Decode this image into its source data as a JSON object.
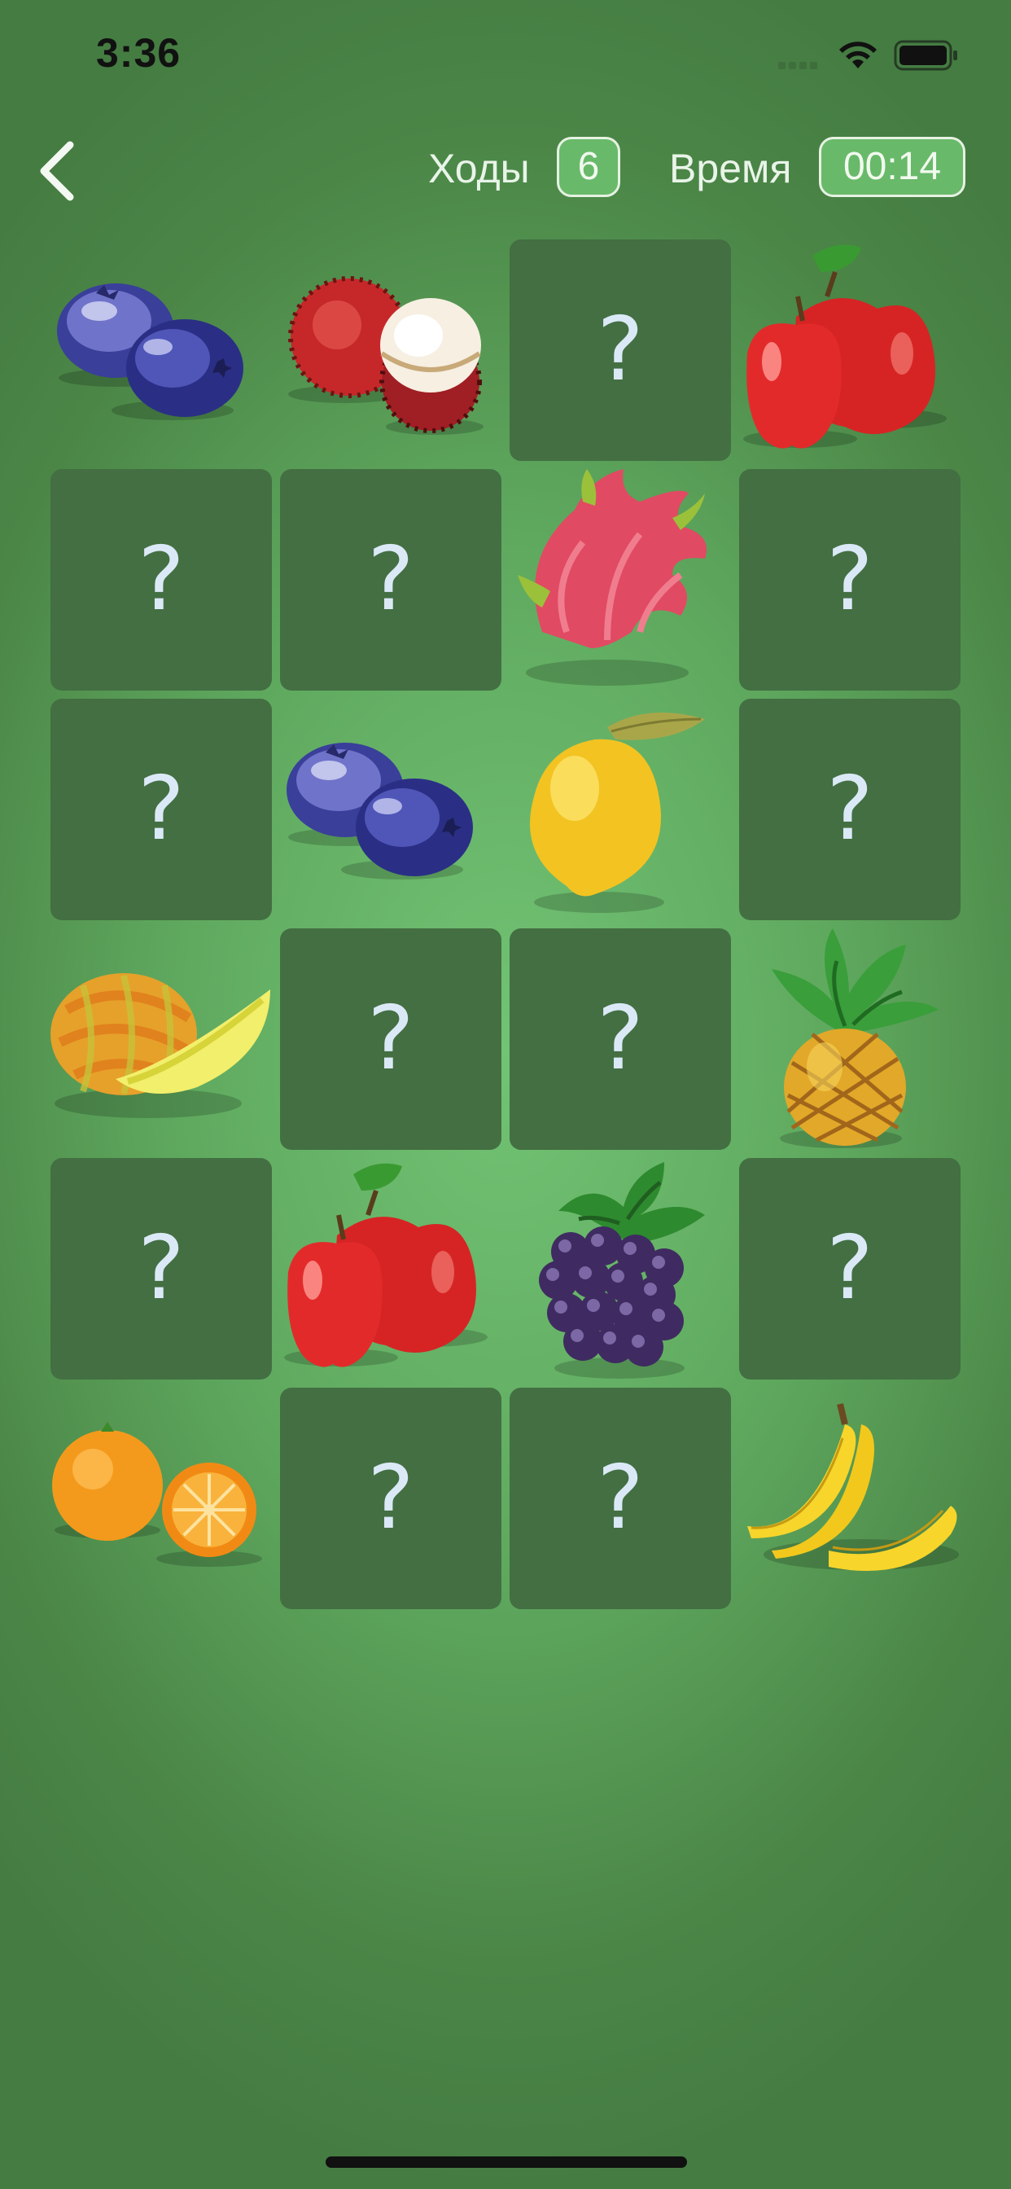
{
  "status_bar": {
    "time": "3:36"
  },
  "header": {
    "moves_label": "Ходы",
    "moves_value": "6",
    "time_label": "Время",
    "time_value": "00:14"
  },
  "board": {
    "hidden_symbol": "?",
    "rows": 6,
    "cols": 4,
    "cards": [
      {
        "state": "open",
        "fruit": "blueberries"
      },
      {
        "state": "open",
        "fruit": "rambutan"
      },
      {
        "state": "hidden",
        "fruit": null
      },
      {
        "state": "open",
        "fruit": "apples"
      },
      {
        "state": "hidden",
        "fruit": null
      },
      {
        "state": "hidden",
        "fruit": null
      },
      {
        "state": "open",
        "fruit": "dragon-fruit"
      },
      {
        "state": "hidden",
        "fruit": null
      },
      {
        "state": "hidden",
        "fruit": null
      },
      {
        "state": "open",
        "fruit": "blueberries"
      },
      {
        "state": "open",
        "fruit": "lemon"
      },
      {
        "state": "hidden",
        "fruit": null
      },
      {
        "state": "open",
        "fruit": "melon"
      },
      {
        "state": "hidden",
        "fruit": null
      },
      {
        "state": "hidden",
        "fruit": null
      },
      {
        "state": "open",
        "fruit": "pineapple"
      },
      {
        "state": "hidden",
        "fruit": null
      },
      {
        "state": "open",
        "fruit": "apples"
      },
      {
        "state": "open",
        "fruit": "blackberry"
      },
      {
        "state": "hidden",
        "fruit": null
      },
      {
        "state": "open",
        "fruit": "oranges"
      },
      {
        "state": "hidden",
        "fruit": null
      },
      {
        "state": "hidden",
        "fruit": null
      },
      {
        "state": "open",
        "fruit": "bananas"
      }
    ]
  },
  "colors": {
    "hidden_card": "#436f42",
    "badge_fill": "#69b96a",
    "badge_border": "#e6f2e2",
    "question_mark": "#dbe9f7"
  }
}
